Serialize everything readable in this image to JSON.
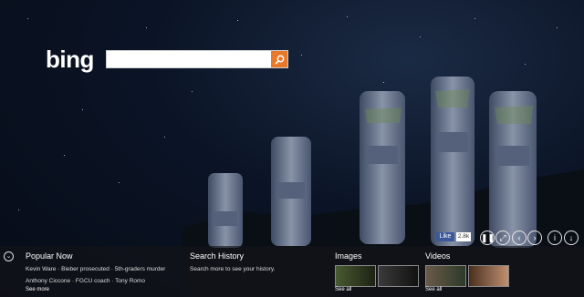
{
  "logo": "bing",
  "search": {
    "value": "",
    "placeholder": ""
  },
  "social": {
    "like_label": "Like",
    "like_count": "2.8k"
  },
  "panel": {
    "popular": {
      "title": "Popular Now",
      "items": [
        "Kevin Ware",
        "Bieber prosecuted",
        "5th-graders murder",
        "Anthony Ciccone",
        "FGCU coach",
        "Tony Romo"
      ],
      "see_more": "See more"
    },
    "history": {
      "title": "Search History",
      "text": "Search more to see your history."
    },
    "images": {
      "title": "Images",
      "see_all": "See all"
    },
    "videos": {
      "title": "Videos",
      "see_all": "See all"
    }
  },
  "colors": {
    "search_button": "#e8792a",
    "facebook": "#3b5998"
  },
  "icons": [
    "search-icon",
    "pause-icon",
    "fullscreen-icon",
    "prev-icon",
    "next-icon",
    "info-icon",
    "download-icon",
    "expand-icon"
  ]
}
